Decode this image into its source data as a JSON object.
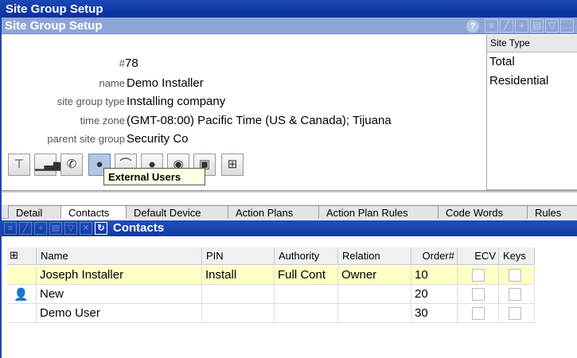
{
  "window_title": "Site Group Setup",
  "panel_title": "Site Group Setup",
  "help_label": "?",
  "toolbar_icons": [
    "list-icon",
    "edit-icon",
    "add-icon",
    "save-icon",
    "filter-icon"
  ],
  "fields": {
    "number": {
      "label": "#",
      "value": "78"
    },
    "name": {
      "label": "name",
      "value": "Demo Installer"
    },
    "site_group_type": {
      "label": "site group type",
      "value": "Installing company"
    },
    "time_zone": {
      "label": "time zone",
      "value": "(GMT-08:00) Pacific Time (US & Canada); Tijuana"
    },
    "parent_site_group": {
      "label": "parent site group",
      "value": "Security Co"
    }
  },
  "action_icons": [
    "filter-icon",
    "signal-icon",
    "phone-icon",
    "user-icon",
    "attach-icon",
    "stop-icon",
    "record-icon",
    "copy-icon",
    "network-icon"
  ],
  "tooltip": "External Users",
  "site_type": {
    "header": "Site Type",
    "items": [
      "Total",
      "Residential"
    ]
  },
  "tabs": [
    "Detail",
    "Contacts",
    "Default Device",
    "Action Plans",
    "Action Plan Rules",
    "Code Words",
    "Rules"
  ],
  "selected_tab": "Contacts",
  "contacts": {
    "title": "Contacts",
    "toolbar_icons": [
      "list-icon",
      "edit-icon",
      "add-icon",
      "save-icon",
      "filter-icon",
      "delete-icon",
      "refresh-icon"
    ],
    "columns": [
      "Name",
      "PIN",
      "Authority",
      "Relation",
      "Order#",
      "ECV",
      "Keys"
    ],
    "rows": [
      {
        "name": "Joseph Installer",
        "pin": "Install",
        "authority": "Full Cont",
        "relation": "Owner",
        "order": "10",
        "ecv": false,
        "keys": false,
        "icon": ""
      },
      {
        "name": "New",
        "pin": "",
        "authority": "",
        "relation": "",
        "order": "20",
        "ecv": false,
        "keys": false,
        "icon": "user-icon"
      },
      {
        "name": "Demo User",
        "pin": "",
        "authority": "",
        "relation": "",
        "order": "30",
        "ecv": false,
        "keys": false,
        "icon": ""
      }
    ]
  }
}
